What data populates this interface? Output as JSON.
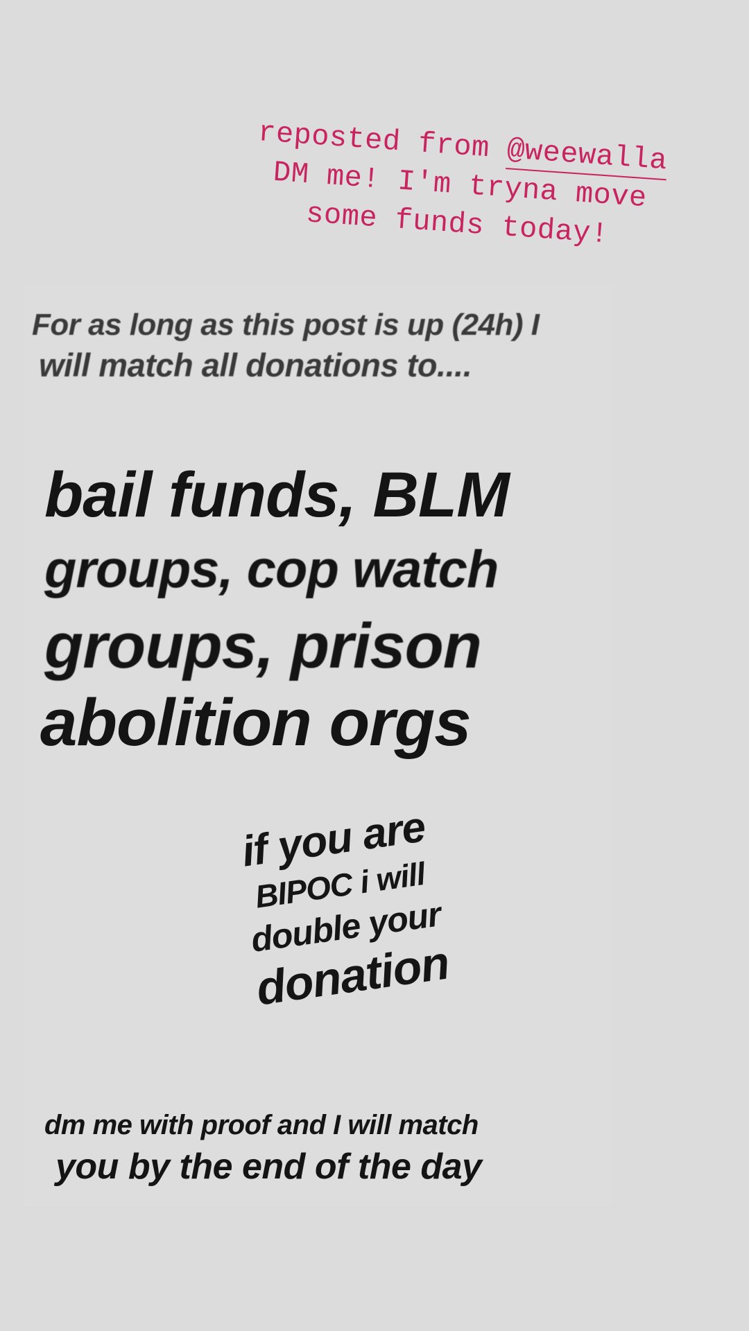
{
  "caption": {
    "line1_prefix": "reposted from ",
    "mention": "@weewalla",
    "line2": "DM me! I'm tryna move",
    "line3": "some funds today!"
  },
  "post": {
    "intro_line1": "For as long as this post is up (24h) I",
    "intro_line2": "will match all donations to....",
    "headline_line1": "bail funds, BLM",
    "headline_line2": "groups, cop watch",
    "headline_line3": "groups, prison",
    "headline_line4": "abolition orgs",
    "bipoc_line1": "if you are",
    "bipoc_line2": "BIPOC i will",
    "bipoc_line3": "double your",
    "bipoc_line4": "donation",
    "footer_line1": "dm me with proof and I will match",
    "footer_line2": "you by the end of the day"
  },
  "colors": {
    "background": "#dcdcdc",
    "caption": "#c8245f",
    "text": "#141414"
  }
}
